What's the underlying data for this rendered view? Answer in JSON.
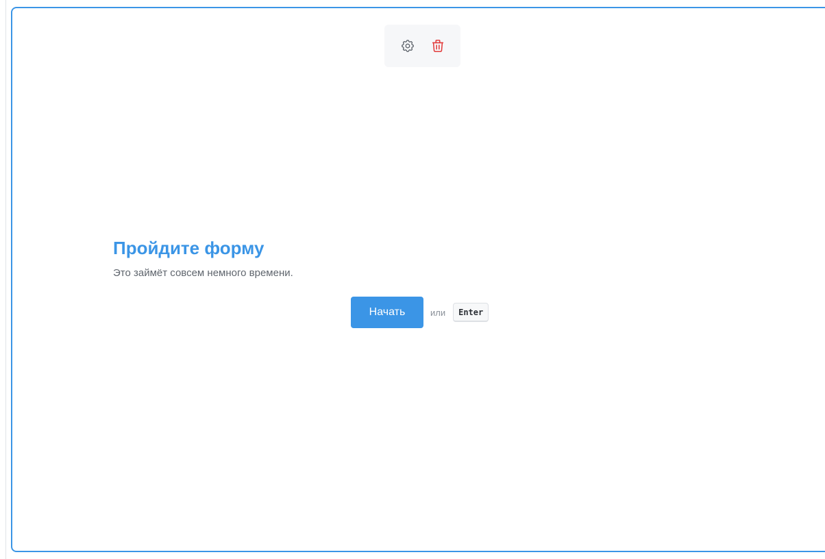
{
  "toolbar": {
    "settings_icon": "gear-icon",
    "delete_icon": "trash-icon",
    "delete_color": "#e23c3c"
  },
  "form_intro": {
    "title": "Пройдите форму",
    "subtitle": "Это займёт совсем немного времени.",
    "start_label": "Начать",
    "or_label": "или",
    "key_hint": "Enter"
  },
  "colors": {
    "accent": "#3b95e6",
    "card_border": "#3b95e6",
    "toolbar_bg": "#f6f7f9"
  }
}
